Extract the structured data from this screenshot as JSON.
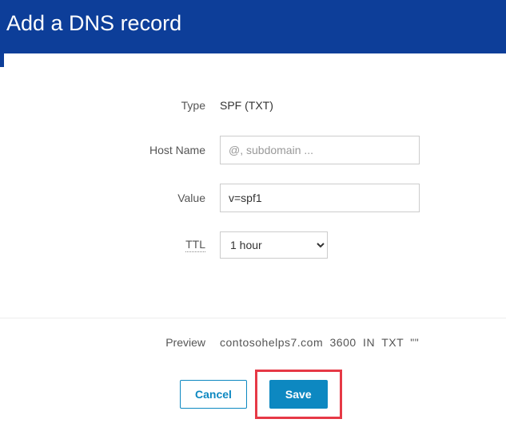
{
  "header": {
    "title": "Add a DNS record"
  },
  "form": {
    "type_label": "Type",
    "type_value": "SPF (TXT)",
    "hostname_label": "Host Name",
    "hostname_placeholder": "@, subdomain ...",
    "hostname_value": "",
    "value_label": "Value",
    "value_value": "v=spf1",
    "ttl_label": "TTL",
    "ttl_selected": "1 hour"
  },
  "preview": {
    "label": "Preview",
    "value": "contosohelps7.com  3600  IN  TXT  \"\""
  },
  "buttons": {
    "cancel": "Cancel",
    "save": "Save"
  }
}
